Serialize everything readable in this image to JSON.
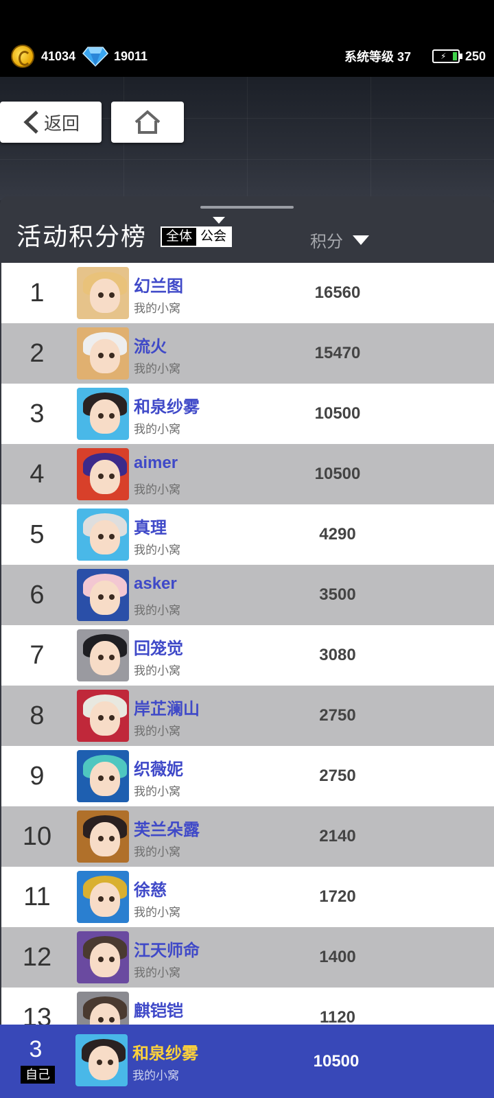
{
  "status": {
    "coins": "41034",
    "gems": "19011",
    "system_level": "系统等级 37",
    "stamina": "250"
  },
  "nav": {
    "back_label": "返回"
  },
  "board": {
    "title": "活动积分榜",
    "tab_all": "全体",
    "tab_guild": "公会",
    "score_header": "积分"
  },
  "rows": [
    {
      "rank": "1",
      "name": "幻兰图",
      "guild": "我的小窝",
      "score": "16560",
      "hair": "#e9c27a",
      "frame": "#e6c38a"
    },
    {
      "rank": "2",
      "name": "流火",
      "guild": "我的小窝",
      "score": "15470",
      "hair": "#eeeeee",
      "frame": "#e0b070"
    },
    {
      "rank": "3",
      "name": "和泉纱雾",
      "guild": "我的小窝",
      "score": "10500",
      "hair": "#2a2222",
      "frame": "#49b8e8"
    },
    {
      "rank": "4",
      "name": "aimer",
      "guild": "我的小窝",
      "score": "10500",
      "hair": "#3c2a8a",
      "frame": "#d8402a"
    },
    {
      "rank": "5",
      "name": "真理",
      "guild": "我的小窝",
      "score": "4290",
      "hair": "#dedede",
      "frame": "#49b8e8"
    },
    {
      "rank": "6",
      "name": "asker",
      "guild": "我的小窝",
      "score": "3500",
      "hair": "#f3c7d2",
      "frame": "#2a4fa8"
    },
    {
      "rank": "7",
      "name": "回笼觉",
      "guild": "我的小窝",
      "score": "3080",
      "hair": "#1e1e22",
      "frame": "#9a9aa0"
    },
    {
      "rank": "8",
      "name": "岸芷澜山",
      "guild": "我的小窝",
      "score": "2750",
      "hair": "#e8e8e0",
      "frame": "#c0283a"
    },
    {
      "rank": "9",
      "name": "织薇妮",
      "guild": "我的小窝",
      "score": "2750",
      "hair": "#4fc7c0",
      "frame": "#1e5fb0"
    },
    {
      "rank": "10",
      "name": "芙兰朵露",
      "guild": "我的小窝",
      "score": "2140",
      "hair": "#2a2020",
      "frame": "#b0702a"
    },
    {
      "rank": "11",
      "name": "徐慈",
      "guild": "我的小窝",
      "score": "1720",
      "hair": "#d9b030",
      "frame": "#2a7fd0"
    },
    {
      "rank": "12",
      "name": "江天师命",
      "guild": "我的小窝",
      "score": "1400",
      "hair": "#4a3a30",
      "frame": "#6a4aa0"
    },
    {
      "rank": "13",
      "name": "麒铠铠",
      "guild": "",
      "score": "1120",
      "hair": "#4a3a30",
      "frame": "#8a8a90"
    }
  ],
  "self": {
    "rank": "3",
    "tag": "自己",
    "name": "和泉纱雾",
    "guild": "我的小窝",
    "score": "10500",
    "hair": "#2a2222",
    "frame": "#49b8e8"
  }
}
